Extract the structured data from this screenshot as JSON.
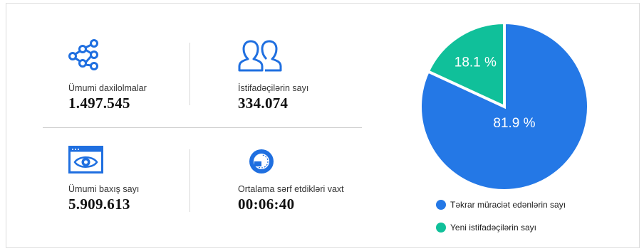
{
  "stats": {
    "total_entries": {
      "label": "Ümumi daxilolmalar",
      "value": "1.497.545",
      "icon": "network-icon"
    },
    "users": {
      "label": "İstifadəçilərin sayı",
      "value": "334.074",
      "icon": "users-icon"
    },
    "page_views": {
      "label": "Ümumi baxış sayı",
      "value": "5.909.613",
      "icon": "eye-window-icon"
    },
    "avg_time": {
      "label": "Ortalama sərf etdikləri vaxt",
      "value": "00:06:40",
      "icon": "clock-icon"
    }
  },
  "colors": {
    "accent": "#1f6fe0",
    "returning": "#2478e6",
    "new": "#10c09a"
  },
  "chart_data": {
    "type": "pie",
    "slices": [
      {
        "name": "Təkrar müraciət edənlərin sayı",
        "value": 81.9,
        "label": "81.9 %",
        "color": "#2478e6"
      },
      {
        "name": "Yeni istifadəçilərin sayı",
        "value": 18.1,
        "label": "18.1 %",
        "color": "#10c09a"
      }
    ],
    "legend": "bottom"
  }
}
